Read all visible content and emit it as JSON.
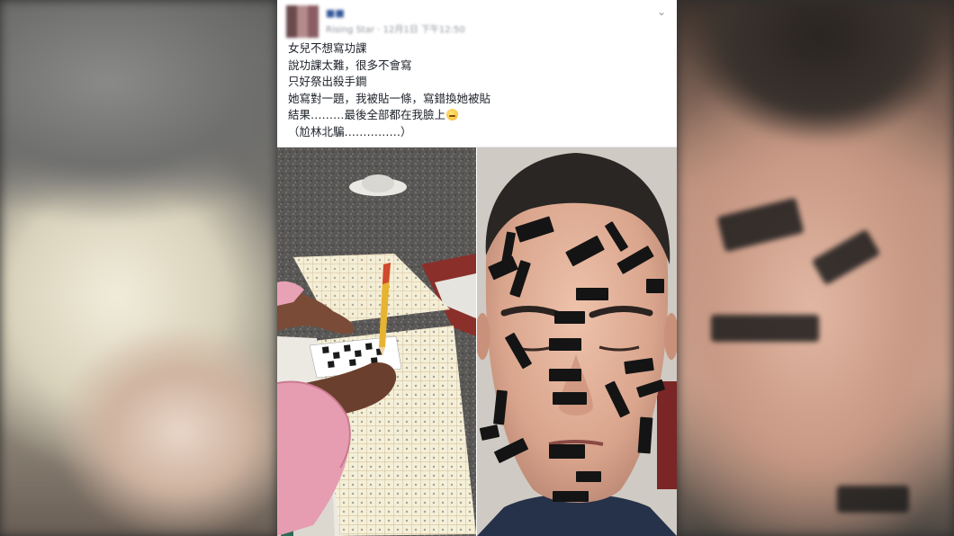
{
  "post": {
    "author_name": "■■",
    "author_meta": "Rising Star · 12月1日 下午12:50",
    "lines": [
      "女兒不想寫功課",
      "說功課太難，很多不會寫",
      "只好祭出殺手鐧",
      "她寫對一題，我被貼一條，寫錯換她被貼",
      "結果………最後全部都在我臉上",
      "（尬林北騙……………）"
    ],
    "options_icon": "chevron-down-icon"
  },
  "photos": {
    "left": "homework-photo",
    "right": "taped-face-photo"
  },
  "colors": {
    "link": "#365899",
    "meta": "#90949c",
    "text": "#1d2129",
    "tape": "#151515"
  }
}
